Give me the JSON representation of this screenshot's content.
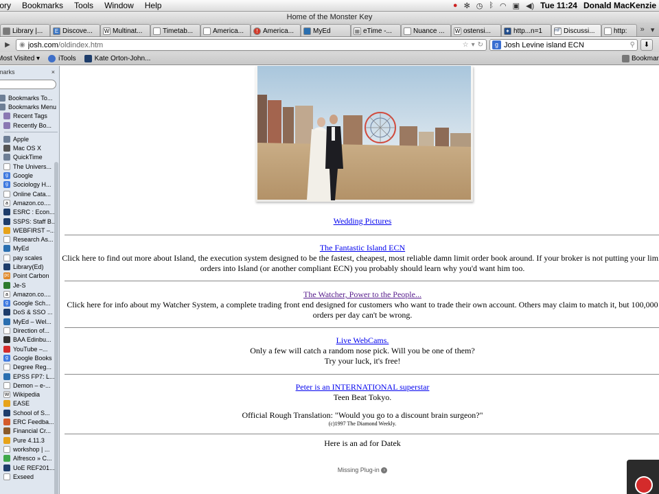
{
  "menubar": {
    "items": [
      "tory",
      "Bookmarks",
      "Tools",
      "Window",
      "Help"
    ],
    "clock": "Tue 11:24",
    "user": "Donald MacKenzie"
  },
  "window": {
    "title": "Home of the Monster Key"
  },
  "tabs": [
    {
      "label": "Library |...",
      "icon": "book-icon",
      "color": "#7a7a7a"
    },
    {
      "label": "Discove...",
      "icon": "e-icon",
      "color": "#3b76c4"
    },
    {
      "label": "Multinat...",
      "icon": "wikipedia-icon",
      "color": "#ffffff"
    },
    {
      "label": "Timetab...",
      "icon": "page-icon",
      "color": "#ffffff"
    },
    {
      "label": "America...",
      "icon": "page-icon",
      "color": "#ffffff"
    },
    {
      "label": "America...",
      "icon": "red-circle-icon",
      "color": "#d23a2a"
    },
    {
      "label": "MyEd",
      "icon": "myed-icon",
      "color": "#2a6fb0"
    },
    {
      "label": "eTime -...",
      "icon": "chart-icon",
      "color": "#ffffff"
    },
    {
      "label": "Nuance ...",
      "icon": "page-icon",
      "color": "#ffffff"
    },
    {
      "label": "ostensi...",
      "icon": "wikipedia-icon",
      "color": "#ffffff"
    },
    {
      "label": "http...n=1",
      "icon": "star-icon",
      "color": "#1f4b8a"
    },
    {
      "label": "Discussi...",
      "icon": "hft-icon",
      "color": "#ffffff"
    },
    {
      "label": "http:",
      "icon": "page-icon",
      "color": "#ffffff"
    }
  ],
  "nav": {
    "url_host": "josh.com",
    "url_path": "/oldindex.htm",
    "search_query": "Josh Levine island ECN"
  },
  "bookmarks_toolbar": {
    "items": [
      {
        "label": "Most Visited ▾",
        "color": "#9b9b9b"
      },
      {
        "label": "iTools",
        "color": "#3f6fc8"
      },
      {
        "label": "Kate Orton-John...",
        "color": "#1e3d6b"
      }
    ],
    "right_label": "Bookmar"
  },
  "sidebar": {
    "title": "marks",
    "close": "×",
    "top_items": [
      {
        "label": "Bookmarks To...",
        "color": "#6e7f96",
        "glyph": ""
      },
      {
        "label": "Bookmarks Menu",
        "color": "#6e7f96",
        "glyph": ""
      }
    ],
    "sub_items": [
      {
        "label": "Recent Tags",
        "color": "#8a78b3",
        "glyph": ""
      },
      {
        "label": "Recently Bo...",
        "color": "#8a78b3",
        "glyph": ""
      }
    ],
    "items": [
      {
        "label": "Apple",
        "color": "#6e7f96",
        "glyph": ""
      },
      {
        "label": "Mac OS X",
        "color": "#555555",
        "glyph": ""
      },
      {
        "label": "QuickTime",
        "color": "#6e7f96",
        "glyph": ""
      },
      {
        "label": "The Univers...",
        "color": "#ffffff",
        "glyph": ""
      },
      {
        "label": "Google",
        "color": "#3f7ae0",
        "glyph": "g"
      },
      {
        "label": "Sociology H...",
        "color": "#3f7ae0",
        "glyph": "g"
      },
      {
        "label": "Online Cata...",
        "color": "#ffffff",
        "glyph": ""
      },
      {
        "label": "Amazon.co....",
        "color": "#ffffff",
        "glyph": "a"
      },
      {
        "label": "ESRC : Econ...",
        "color": "#1e3d6b",
        "glyph": ""
      },
      {
        "label": "SSPS: Staff B...",
        "color": "#1e3d6b",
        "glyph": ""
      },
      {
        "label": "WEBFIRST –...",
        "color": "#e7a31a",
        "glyph": ""
      },
      {
        "label": "Research As...",
        "color": "#ffffff",
        "glyph": ""
      },
      {
        "label": "MyEd",
        "color": "#2a6fb0",
        "glyph": ""
      },
      {
        "label": "pay scales",
        "color": "#ffffff",
        "glyph": ""
      },
      {
        "label": "Library(Ed)",
        "color": "#1e3d6b",
        "glyph": ""
      },
      {
        "label": "Point Carbon",
        "color": "#e0892a",
        "glyph": "pc"
      },
      {
        "label": "Je-S",
        "color": "#2d7a2d",
        "glyph": ""
      },
      {
        "label": "Amazon.co....",
        "color": "#ffffff",
        "glyph": "a"
      },
      {
        "label": "Google Sch...",
        "color": "#3f7ae0",
        "glyph": "g"
      },
      {
        "label": "DoS & SSO ...",
        "color": "#1e3d6b",
        "glyph": ""
      },
      {
        "label": "MyEd – Wel...",
        "color": "#2a6fb0",
        "glyph": ""
      },
      {
        "label": "Direction of...",
        "color": "#ffffff",
        "glyph": ""
      },
      {
        "label": "BAA Edinbu...",
        "color": "#333333",
        "glyph": ""
      },
      {
        "label": "YouTube –...",
        "color": "#d42b2b",
        "glyph": ""
      },
      {
        "label": "Google Books",
        "color": "#3f7ae0",
        "glyph": "g"
      },
      {
        "label": "Degree Reg...",
        "color": "#ffffff",
        "glyph": ""
      },
      {
        "label": "EPSS FP7: L...",
        "color": "#2a6fb0",
        "glyph": ""
      },
      {
        "label": "Demon – e-...",
        "color": "#ffffff",
        "glyph": ""
      },
      {
        "label": "Wikipedia",
        "color": "#ffffff",
        "glyph": "W"
      },
      {
        "label": "EASE",
        "color": "#e7a31a",
        "glyph": ""
      },
      {
        "label": "School of S...",
        "color": "#1e3d6b",
        "glyph": ""
      },
      {
        "label": "ERC Feedba...",
        "color": "#d45a2a",
        "glyph": ""
      },
      {
        "label": "Financial Cr...",
        "color": "#8a5a2a",
        "glyph": ""
      },
      {
        "label": "Pure 4.11.3",
        "color": "#e7a31a",
        "glyph": ""
      },
      {
        "label": "workshop | ...",
        "color": "#ffffff",
        "glyph": ""
      },
      {
        "label": "Alfresco » C...",
        "color": "#3fa84a",
        "glyph": ""
      },
      {
        "label": "UoE REF201...",
        "color": "#1e3d6b",
        "glyph": ""
      },
      {
        "label": "Exseed",
        "color": "#ffffff",
        "glyph": ""
      }
    ]
  },
  "page": {
    "wedding_link": "Wedding Pictures",
    "island_link": "The Fantastic Island ECN",
    "island_text_1": "Click here to find out more about Island, the execution system designed to be the fastest, cheapest, most reliable damn limit order book around. If your broker is not putting your limit",
    "island_text_2": "orders into Island (or another compliant ECN) you probably should learn why you'd want him too.",
    "watcher_link": "The Watcher, Power to the People...",
    "watcher_text_1": "Click here for info about my Watcher System, a complete trading front end designed for customers who want to trade their own account. Others may claim to match it, but 100,000",
    "watcher_text_2": "orders per day can't be wrong.",
    "webcam_link": "Live WebCams.",
    "webcam_text_1": "Only a few will catch a random nose pick. Will you be one of them?",
    "webcam_text_2": "Try your luck, it's free!",
    "peter_link": "Peter is an INTERNATIONAL superstar",
    "peter_text_1": "Teen Beat Tokyo.",
    "peter_text_2": "Official Rough Translation: \"Would you go to a discount brain surgeon?\"",
    "peter_copyright": "(c)1997 The Diamond Weekly.",
    "ad_text": "Here is an ad for Datek",
    "plugin_text": "Missing Plug-in"
  }
}
